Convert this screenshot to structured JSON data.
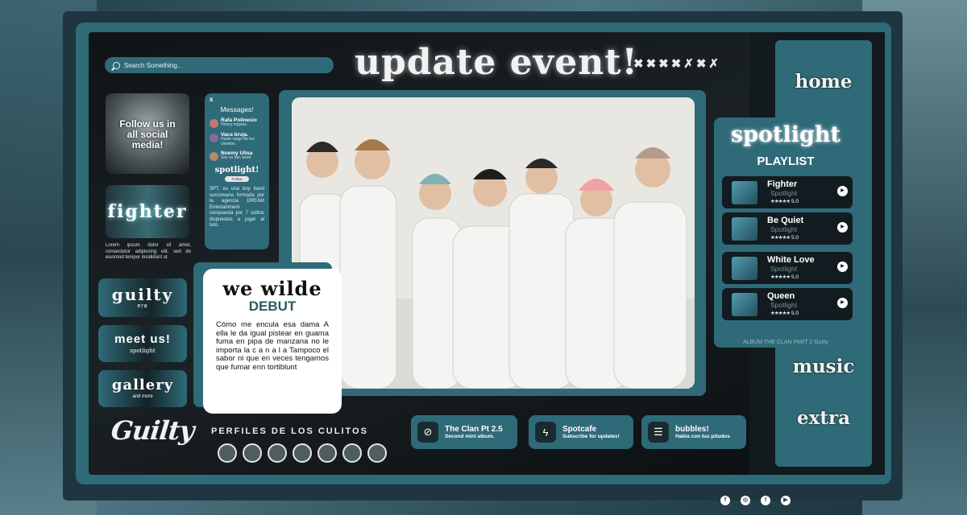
{
  "search": {
    "placeholder": "Search Something.."
  },
  "header": {
    "title": "update event!",
    "marks": "✖✖✖✖✗✖✗"
  },
  "left": {
    "follow": "Follow us in all social media!",
    "fighter": "fighter",
    "lorem": "Lorem ipsum dolor sit amet, consectetur adipiscing elit, sed do eiusmod tempor incididunt ut",
    "guilty_title": "guilty",
    "guilty_sub": "era",
    "meet_title": "meet us!",
    "meet_sub": "spotlight",
    "gallery_title": "gallery",
    "gallery_sub": "and more",
    "logo": "Guilty"
  },
  "messages": {
    "close": "x",
    "title": "Messages!",
    "items": [
      {
        "name": "Rafa Polinesio",
        "text": "Honey mgstas."
      },
      {
        "name": "Vaca bruja.",
        "text": "Hazte cargo de los cheetos."
      },
      {
        "name": "Noemy Ulloa",
        "text": "Soy su fan, besit."
      }
    ],
    "group": "spotlight!",
    "follow_btn": "Follow",
    "desc": "SPT, es una boy band surcoreana formada por la agencia DREAM Entertainment compuesta por 7 culitos dispuestos a jugar al teto."
  },
  "card": {
    "title": "we wilde",
    "subtitle": "DEBUT",
    "body": "Cómo me encula esa dama A ella le da igual pistear en guama fuma en pipa de manzana no le importa la c a n a l a Tampoco el sabor ni que en veces tengamos que fumar enn tortiblunt"
  },
  "profiles": {
    "title": "PERFILES DE LOS CULITOS",
    "count": 7
  },
  "pills": [
    {
      "icon": "⊘",
      "title": "The Clan Pt 2.5",
      "sub": "Second mini album."
    },
    {
      "icon": "ϟ",
      "title": "Spotcafe",
      "sub": "Subscribe for updates!"
    },
    {
      "icon": "☰",
      "title": "bubbles!",
      "sub": "Habla con tus pitudos"
    }
  ],
  "nav": {
    "home": "home",
    "music": "music",
    "extra": "extra"
  },
  "spotlight": {
    "title": "spotlight",
    "subtitle": "PLAYLIST",
    "footer": "ALBUM THE CLAN PART 2 Guilty",
    "songs": [
      {
        "name": "Fighter",
        "artist": "Spotlight",
        "rating": "5.0"
      },
      {
        "name": "Be Quiet",
        "artist": "Spotlight",
        "rating": "5.0"
      },
      {
        "name": "White Love",
        "artist": "Spotlight",
        "rating": "5.0"
      },
      {
        "name": "Queen",
        "artist": "Spotlight",
        "rating": "5.0"
      }
    ]
  },
  "social": [
    "f",
    "◎",
    "t",
    "▶"
  ]
}
